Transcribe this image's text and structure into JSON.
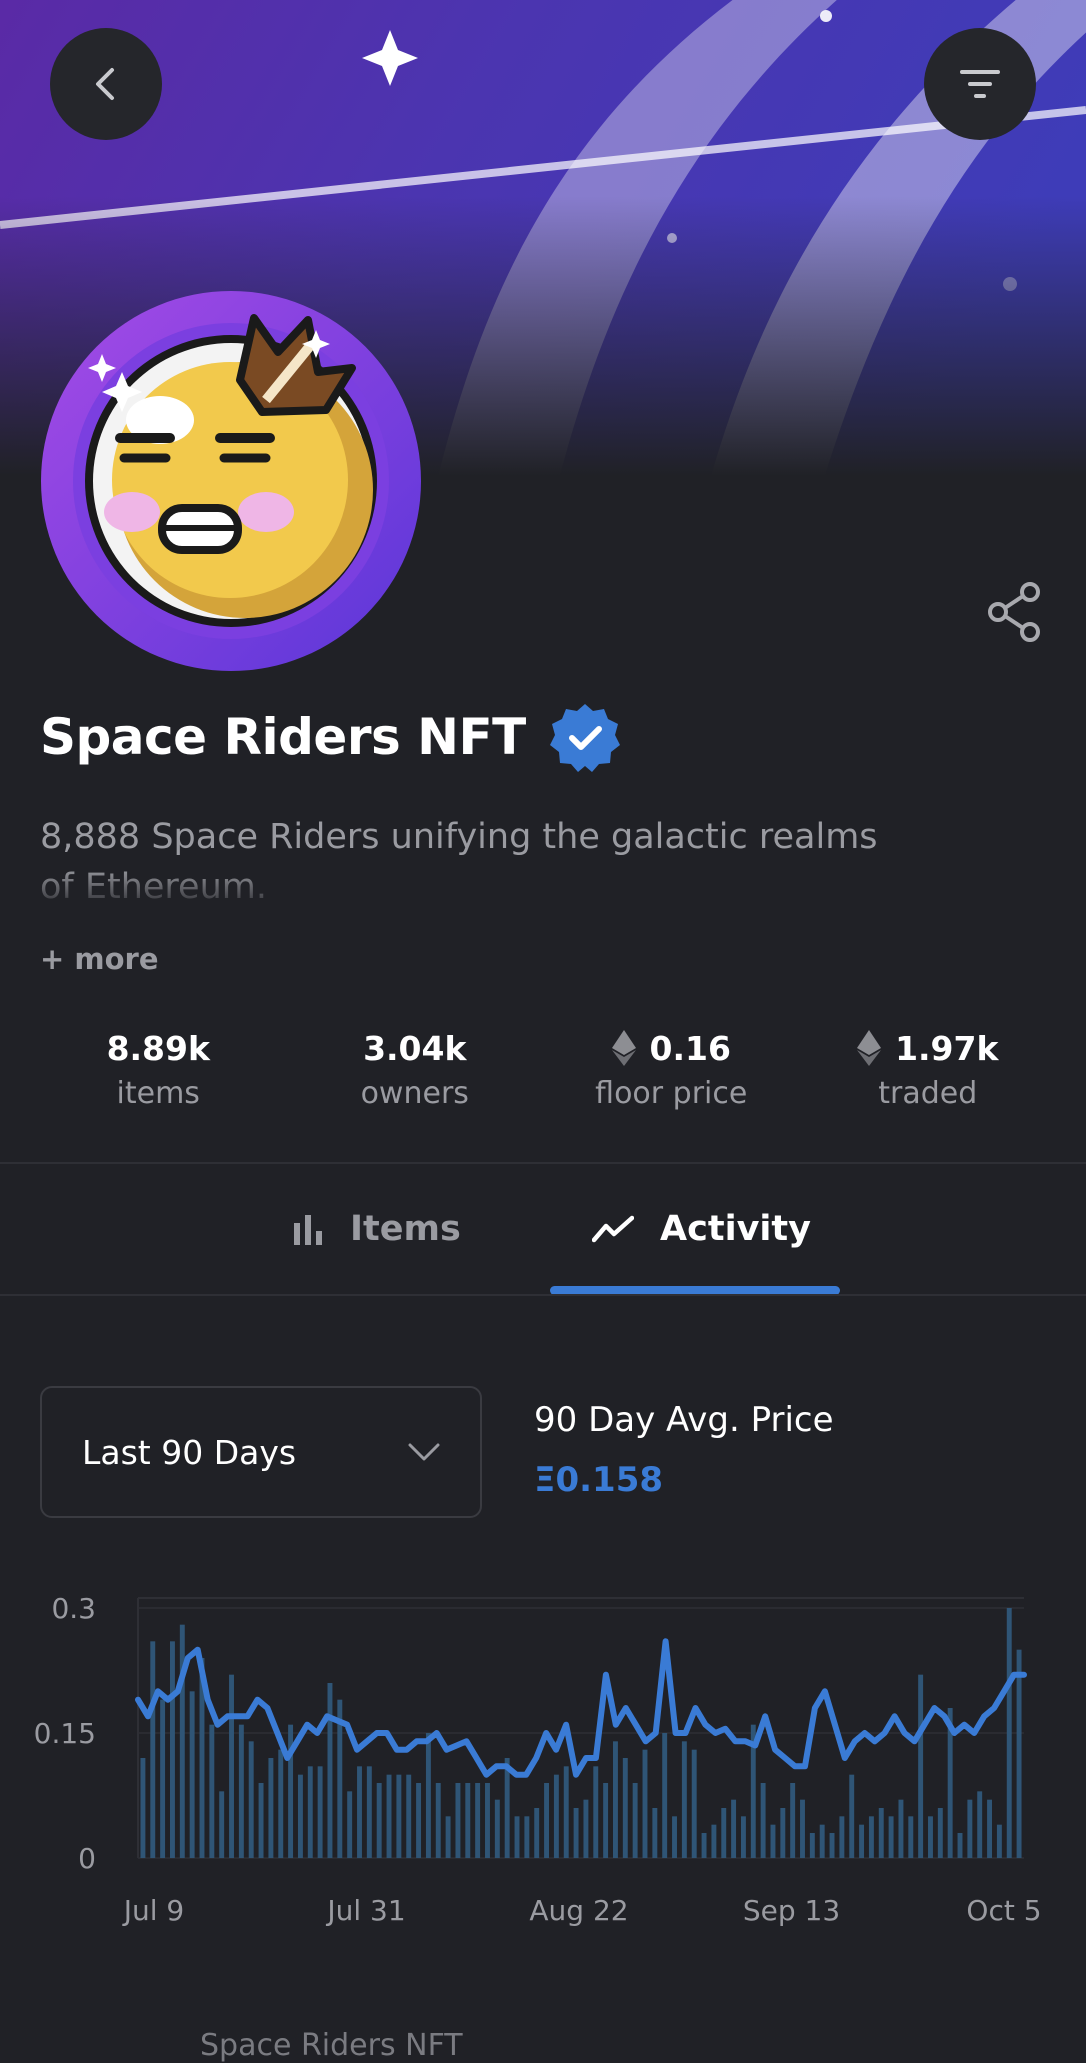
{
  "collection": {
    "title": "Space Riders NFT",
    "description": "8,888 Space Riders unifying the galactic realms of Ethereum.",
    "more_label": "+ more"
  },
  "stats": [
    {
      "value": "8.89k",
      "label": "items",
      "icon": ""
    },
    {
      "value": "3.04k",
      "label": "owners",
      "icon": ""
    },
    {
      "value": "0.16",
      "label": "floor price",
      "icon": "ethereum-icon"
    },
    {
      "value": "1.97k",
      "label": "traded",
      "icon": "ethereum-icon"
    }
  ],
  "tabs": [
    {
      "label": "Items",
      "icon": "bar-chart-icon",
      "active": false
    },
    {
      "label": "Activity",
      "icon": "trend-line-icon",
      "active": true
    }
  ],
  "filter": {
    "selected": "Last 90 Days"
  },
  "avg_price": {
    "label": "90 Day Avg. Price",
    "value": "Ξ0.158"
  },
  "footer_peek": "Space Riders NFT",
  "colors": {
    "accent": "#3a7bd5",
    "background": "#202126",
    "bars": "#2f5576"
  },
  "chart_data": {
    "type": "line",
    "x_tick_labels": [
      "Jul 9",
      "Jul 31",
      "Aug 22",
      "Sep 13",
      "Oct 5"
    ],
    "y_tick_labels": [
      "0.3",
      "0.15",
      "0"
    ],
    "ylim": [
      0,
      0.3
    ],
    "grid": true,
    "series": [
      {
        "type": "line",
        "values": [
          0.19,
          0.17,
          0.2,
          0.19,
          0.2,
          0.24,
          0.25,
          0.19,
          0.16,
          0.17,
          0.17,
          0.17,
          0.19,
          0.18,
          0.15,
          0.12,
          0.14,
          0.16,
          0.15,
          0.17,
          0.165,
          0.16,
          0.13,
          0.14,
          0.15,
          0.15,
          0.13,
          0.13,
          0.14,
          0.14,
          0.15,
          0.13,
          0.135,
          0.14,
          0.12,
          0.1,
          0.11,
          0.11,
          0.1,
          0.1,
          0.12,
          0.15,
          0.13,
          0.16,
          0.1,
          0.12,
          0.12,
          0.22,
          0.16,
          0.18,
          0.16,
          0.14,
          0.15,
          0.26,
          0.15,
          0.15,
          0.18,
          0.16,
          0.15,
          0.155,
          0.14,
          0.14,
          0.135,
          0.17,
          0.13,
          0.12,
          0.11,
          0.11,
          0.18,
          0.2,
          0.16,
          0.12,
          0.14,
          0.15,
          0.14,
          0.15,
          0.17,
          0.15,
          0.14,
          0.16,
          0.18,
          0.17,
          0.15,
          0.16,
          0.15,
          0.17,
          0.18,
          0.2,
          0.22,
          0.22
        ]
      },
      {
        "type": "bar",
        "values": [
          0.12,
          0.26,
          0.19,
          0.26,
          0.28,
          0.2,
          0.24,
          0.16,
          0.08,
          0.22,
          0.16,
          0.14,
          0.09,
          0.12,
          0.13,
          0.16,
          0.1,
          0.11,
          0.11,
          0.21,
          0.19,
          0.08,
          0.11,
          0.11,
          0.09,
          0.1,
          0.1,
          0.1,
          0.09,
          0.15,
          0.09,
          0.05,
          0.09,
          0.09,
          0.09,
          0.09,
          0.07,
          0.12,
          0.05,
          0.05,
          0.06,
          0.09,
          0.1,
          0.11,
          0.06,
          0.07,
          0.11,
          0.09,
          0.14,
          0.12,
          0.09,
          0.13,
          0.06,
          0.15,
          0.05,
          0.14,
          0.13,
          0.03,
          0.04,
          0.06,
          0.07,
          0.05,
          0.16,
          0.09,
          0.04,
          0.06,
          0.09,
          0.07,
          0.03,
          0.04,
          0.03,
          0.05,
          0.1,
          0.04,
          0.05,
          0.06,
          0.05,
          0.07,
          0.05,
          0.22,
          0.05,
          0.06,
          0.18,
          0.03,
          0.07,
          0.08,
          0.07,
          0.04,
          0.3,
          0.25
        ]
      }
    ]
  }
}
